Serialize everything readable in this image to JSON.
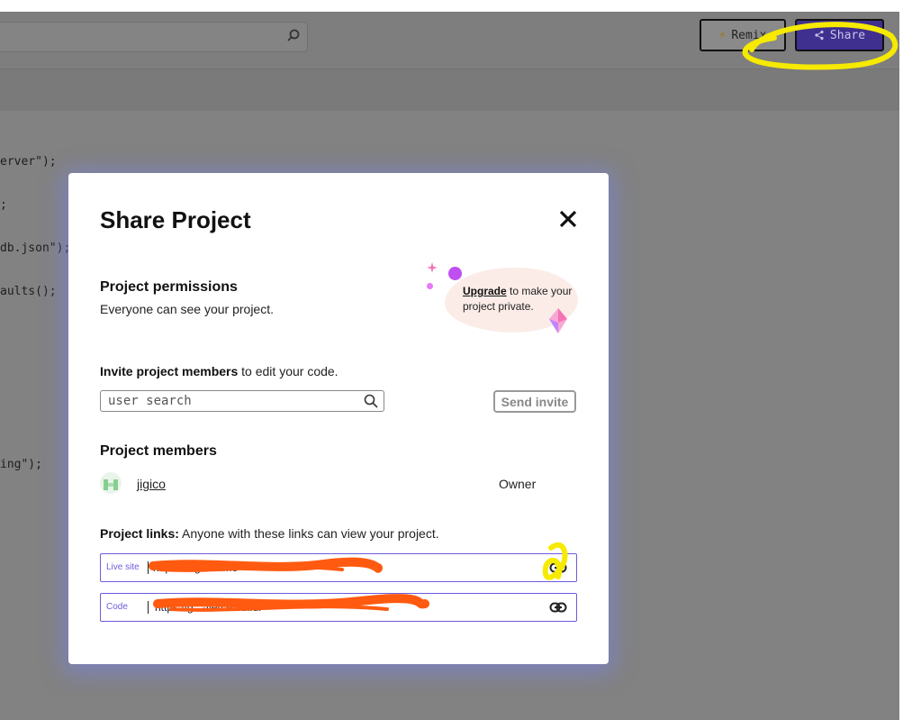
{
  "toolbar": {
    "remix_label": "Remix",
    "share_label": "Share"
  },
  "code_lines": [
    "erver\");",
    ";",
    "db.json\");",
    "aults();",
    "",
    "",
    "",
    "ing\");"
  ],
  "modal": {
    "title": "Share Project",
    "permissions": {
      "title": "Project permissions",
      "subtitle": "Everyone can see your project."
    },
    "upgrade": {
      "link_text": "Upgrade",
      "rest_text": " to make your project private."
    },
    "invite": {
      "label_bold": "Invite project members",
      "label_rest": " to edit your code.",
      "search_placeholder": "user search",
      "send_label": "Send invite"
    },
    "members": {
      "title": "Project members",
      "list": [
        {
          "name": "jigico",
          "role": "Owner"
        }
      ]
    },
    "links": {
      "label_bold": "Project links:",
      "label_rest": " Anyone with these links can view your project.",
      "items": [
        {
          "tag": "Live site",
          "url": "https://...glitch.me"
        },
        {
          "tag": "Code",
          "url": "https://g...-fierce-sulfur"
        }
      ]
    }
  },
  "colors": {
    "share_button": "#3f2f8f",
    "link_border": "#6c5be0",
    "modal_glow": "#7882eb",
    "annotation_yellow": "#f5ea00",
    "redaction_orange": "#ff5a10"
  }
}
